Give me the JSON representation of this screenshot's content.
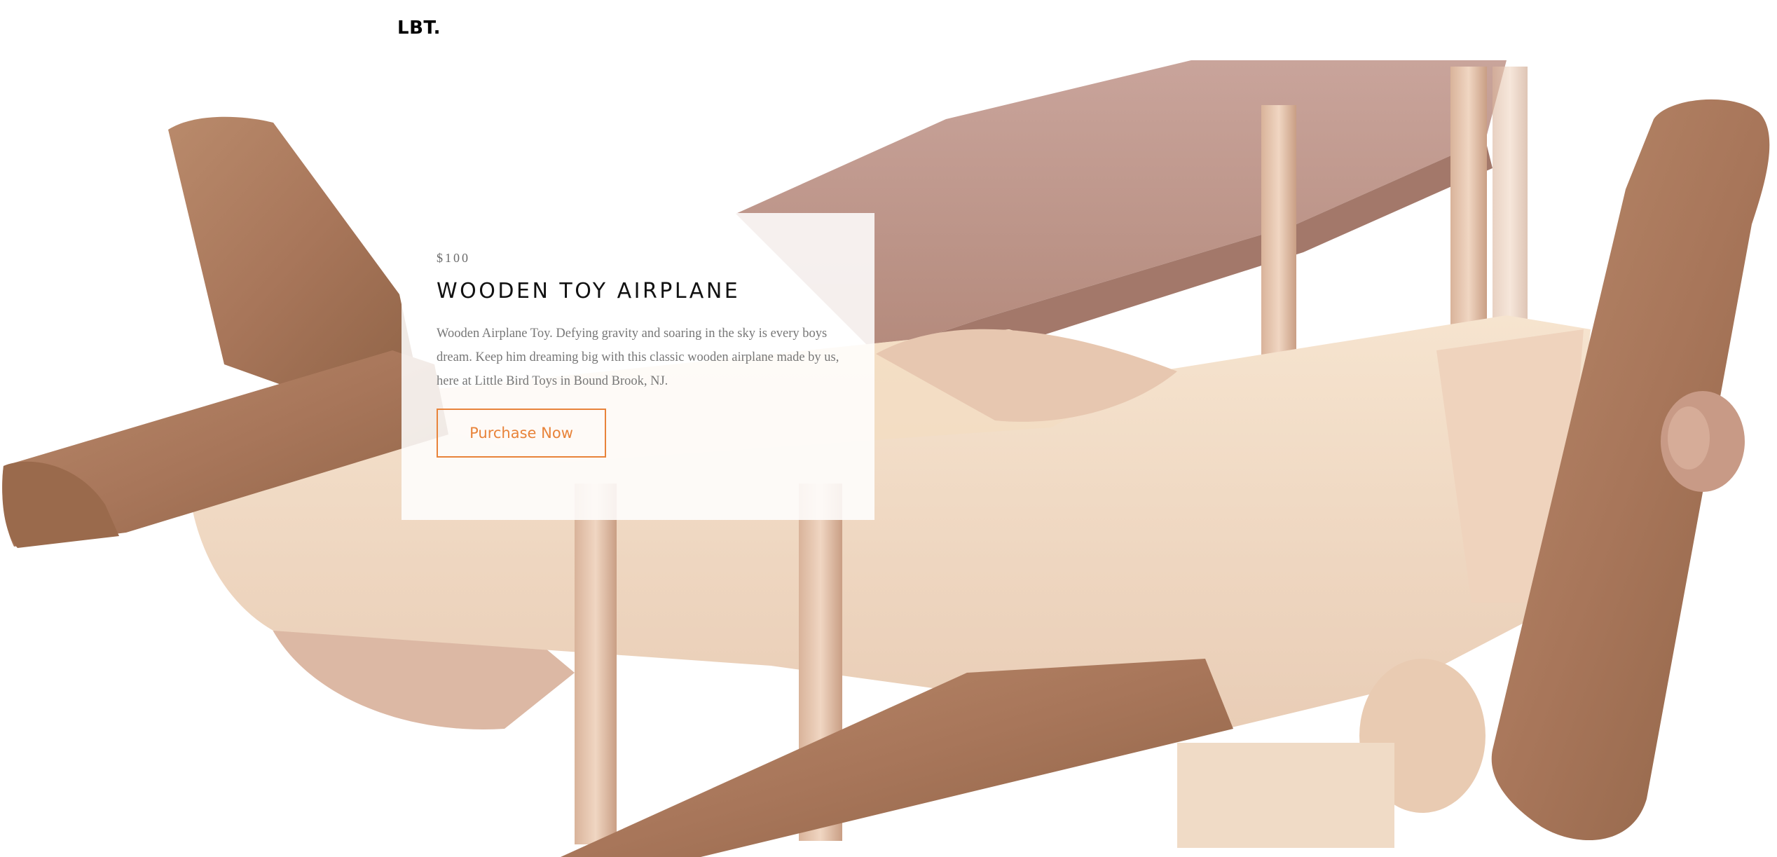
{
  "header": {
    "logo": "LBT."
  },
  "product": {
    "price": "$100",
    "title": "WOODEN TOY AIRPLANE",
    "description": "Wooden Airplane Toy. Defying gravity and soaring in the sky is every boys dream. Keep him dreaming big with this classic wooden airplane made by us, here at Little Bird Toys in Bound Brook, NJ.",
    "cta_label": "Purchase Now"
  },
  "colors": {
    "accent": "#e8833a",
    "card_background": "rgba(255,255,255,0.86)",
    "light_wood": "#f0d9c4",
    "dark_wood": "#b07c5a"
  },
  "hero_image": {
    "subject": "wooden-toy-airplane"
  }
}
